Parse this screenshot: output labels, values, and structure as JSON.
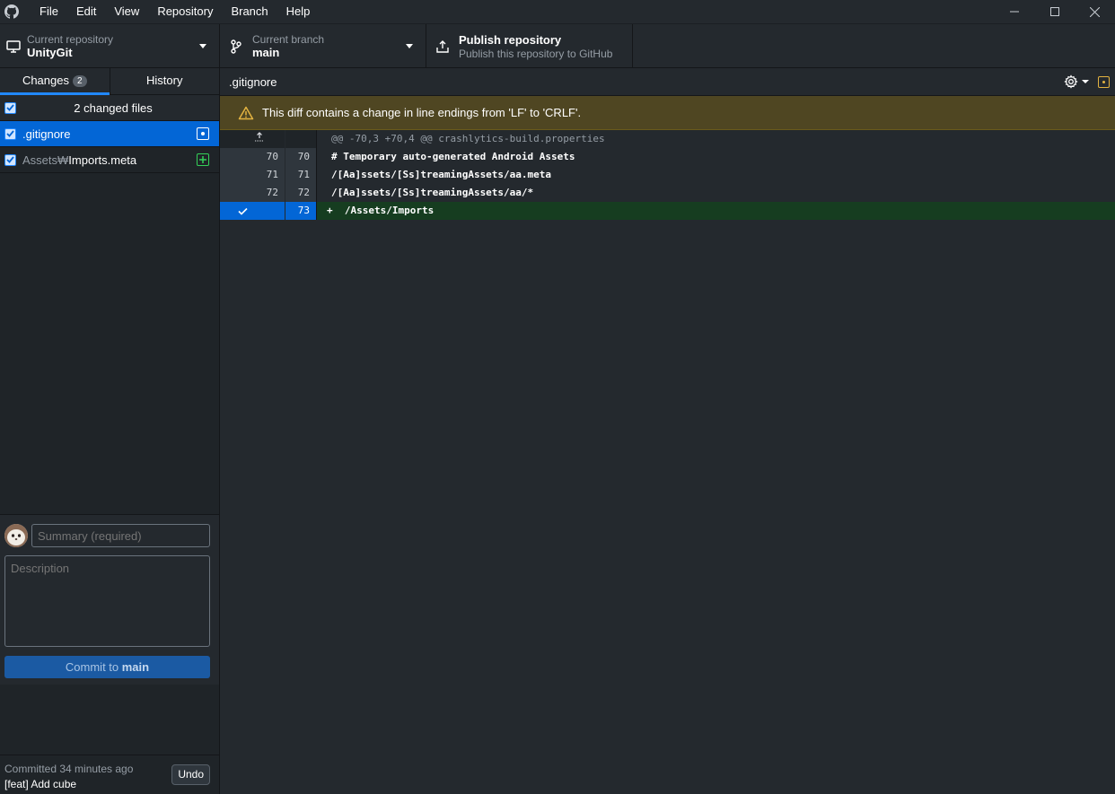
{
  "menu": [
    "File",
    "Edit",
    "View",
    "Repository",
    "Branch",
    "Help"
  ],
  "toolbar": {
    "repo_label": "Current repository",
    "repo_value": "UnityGit",
    "branch_label": "Current branch",
    "branch_value": "main",
    "publish_title": "Publish repository",
    "publish_sub": "Publish this repository to GitHub"
  },
  "tabs": {
    "changes": "Changes",
    "changes_count": "2",
    "history": "History"
  },
  "files": {
    "header": "2 changed files",
    "items": [
      {
        "dir": "",
        "name": ".gitignore",
        "status": "modified"
      },
      {
        "dir": "Assets₩",
        "name": "Imports.meta",
        "status": "added"
      }
    ]
  },
  "commit": {
    "summary_placeholder": "Summary (required)",
    "description_placeholder": "Description",
    "button_prefix": "Commit to ",
    "button_branch": "main"
  },
  "last_commit": {
    "time": "Committed 34 minutes ago",
    "message": "[feat] Add cube",
    "undo": "Undo"
  },
  "diff": {
    "filename": ".gitignore",
    "warning": "This diff contains a change in line endings from 'LF' to 'CRLF'.",
    "hunk": "@@ -70,3 +70,4 @@ crashlytics-build.properties",
    "lines": [
      {
        "old": "70",
        "new": "70",
        "text": "# Temporary auto-generated Android Assets"
      },
      {
        "old": "71",
        "new": "71",
        "text": "/[Aa]ssets/[Ss]treamingAssets/aa.meta"
      },
      {
        "old": "72",
        "new": "72",
        "text": "/[Aa]ssets/[Ss]treamingAssets/aa/*"
      }
    ],
    "added": {
      "new": "73",
      "sign": "+",
      "text": "/Assets/Imports"
    }
  },
  "colors": {
    "accent": "#0366d6",
    "added_bg": "#163d20",
    "warning_bg": "#4f4622",
    "modified": "#e3b341",
    "added": "#34d058"
  }
}
